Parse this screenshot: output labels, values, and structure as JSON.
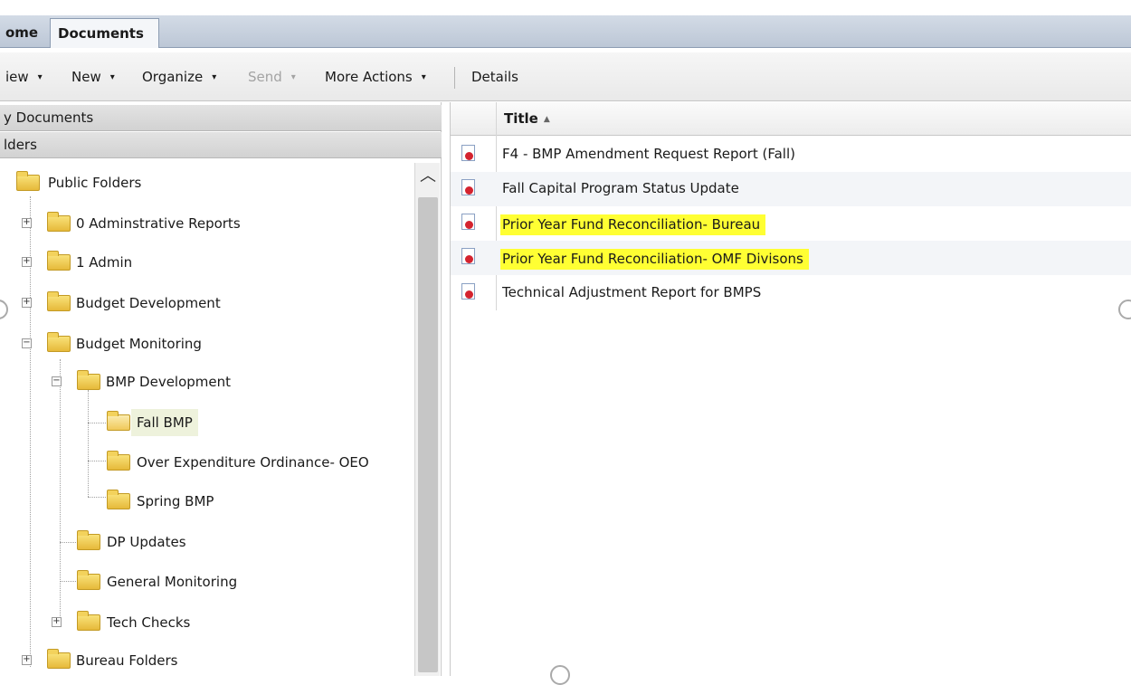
{
  "tabs": [
    {
      "label": "ome"
    },
    {
      "label": "Documents"
    }
  ],
  "toolbar": {
    "view_label": "iew",
    "new_label": "New",
    "organize_label": "Organize",
    "send_label": "Send",
    "more_actions_label": "More Actions",
    "details_label": "Details",
    "dropdown_glyph": "▾"
  },
  "left_panel": {
    "my_documents_label": "y Documents",
    "folders_label": "lders",
    "tree": {
      "public_folders": "Public Folders",
      "admin_reports": "0 Adminstrative Reports",
      "admin": "1 Admin",
      "budget_development": "Budget Development",
      "budget_monitoring": "Budget Monitoring",
      "bmp_development": "BMP Development",
      "fall_bmp": "Fall BMP",
      "over_expenditure": "Over Expenditure Ordinance- OEO",
      "spring_bmp": "Spring BMP",
      "dp_updates": "DP Updates",
      "general_monitoring": "General Monitoring",
      "tech_checks": "Tech Checks",
      "bureau_folders": "Bureau Folders"
    },
    "expand_glyph": "+",
    "collapse_glyph": "−",
    "scroll_up_glyph": "︿"
  },
  "right_panel": {
    "column_title": "Title",
    "sort_glyph": "▲",
    "documents": [
      {
        "title": "F4 - BMP Amendment Request Report (Fall)",
        "highlighted": false
      },
      {
        "title": "Fall Capital Program Status Update",
        "highlighted": false
      },
      {
        "title": "Prior Year Fund Reconciliation- Bureau",
        "highlighted": true
      },
      {
        "title": "Prior Year Fund Reconciliation- OMF Divisons",
        "highlighted": true
      },
      {
        "title": "Technical Adjustment Report for BMPS",
        "highlighted": false
      }
    ]
  },
  "colors": {
    "highlight": "#ffff33",
    "tab_bar": "#c7d1de",
    "folder": "#f0c846"
  }
}
